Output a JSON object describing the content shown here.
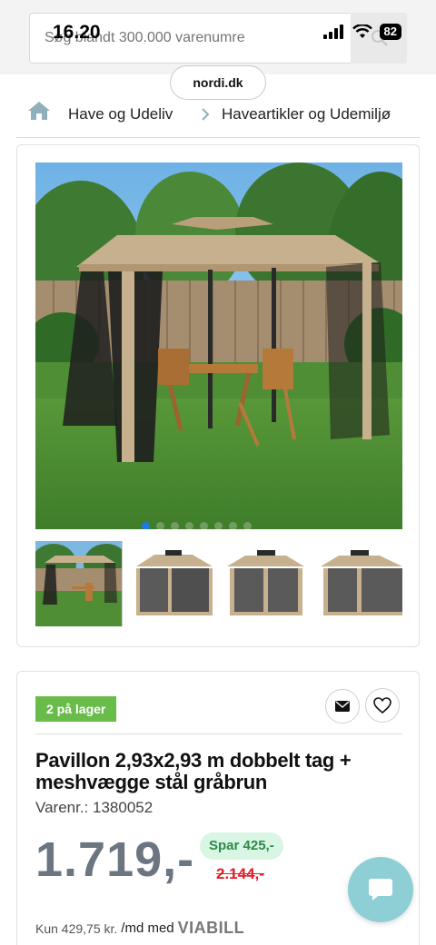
{
  "status": {
    "time": "16.20",
    "battery": "82"
  },
  "search": {
    "placeholder": "Søg blandt 300.000 varenumre"
  },
  "browser": {
    "url": "nordi.dk"
  },
  "breadcrumb": {
    "items": [
      {
        "label": "Have og Udeliv"
      },
      {
        "label": "Haveartikler og Udemiljø"
      }
    ]
  },
  "gallery": {
    "image_count": 8,
    "active_index": 0,
    "thumbnails": [
      "Pavillon i have",
      "Pavillon set skråt",
      "Pavillon set forfra",
      "Pavillon set fra siden"
    ]
  },
  "product": {
    "stock_badge": "2 på lager",
    "title": "Pavillon 2,93x2,93 m dobbelt tag + meshvægge stål gråbrun",
    "sku_label": "Varenr.:",
    "sku": "1380052",
    "price": "1.719,-",
    "save": "Spar 425,-",
    "old_price": "2.144,-",
    "installment_prefix": "Kun 429,75 kr.",
    "installment_suffix": "/md med",
    "installment_provider": "VIABILL"
  },
  "colors": {
    "stock_green": "#69bb4a",
    "save_bg": "#d9f6e4",
    "save_text": "#2a8a45",
    "old_price_red": "#e21f26",
    "price_gray": "#6b7681",
    "dot_active": "#1e7be6",
    "chat_bg": "#8ecfd6"
  },
  "icons": [
    "search-icon",
    "home-icon",
    "chevron-right-icon",
    "envelope-icon",
    "heart-icon",
    "chat-icon",
    "signal-icon",
    "wifi-icon"
  ]
}
